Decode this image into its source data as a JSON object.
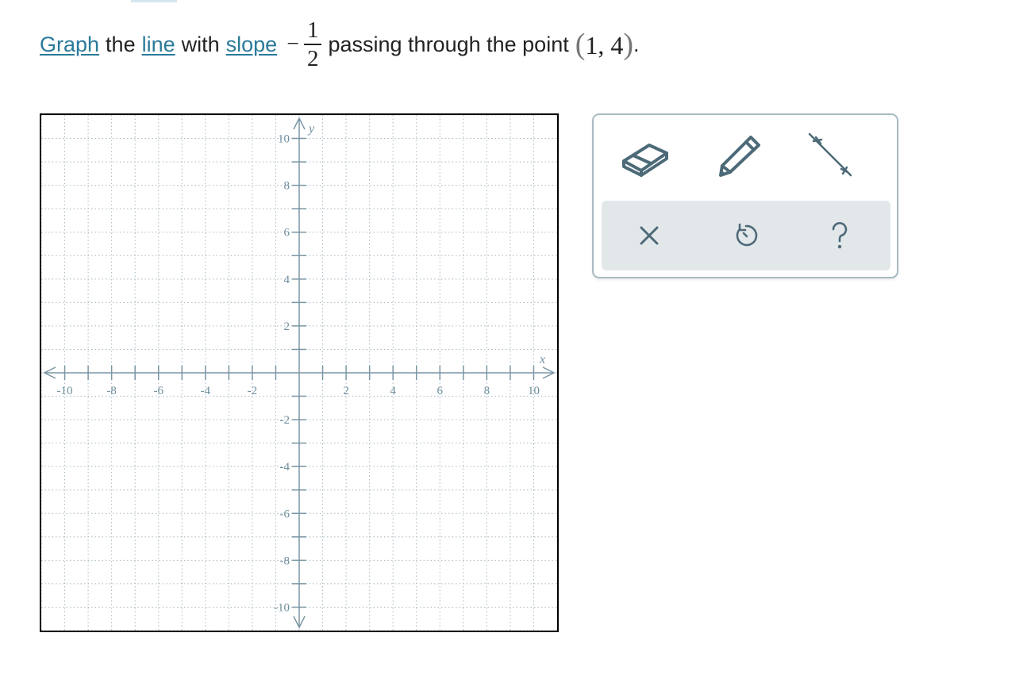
{
  "prompt": {
    "graph_link": "Graph",
    "text_the": "the",
    "line_link": "line",
    "text_with": "with",
    "slope_link": "slope",
    "minus": "−",
    "slope_numerator": "1",
    "slope_denominator": "2",
    "text_passing": "passing through the point",
    "point_open": "(",
    "point_x": "1",
    "point_comma": ",",
    "point_y": "4",
    "point_close": ")",
    "period": "."
  },
  "graph": {
    "x_axis_label": "x",
    "y_axis_label": "y",
    "x_min": -11,
    "x_max": 11,
    "y_min": -11,
    "y_max": 11,
    "x_tick_labels": [
      {
        "value": -10,
        "label": "-10"
      },
      {
        "value": -8,
        "label": "-8"
      },
      {
        "value": -6,
        "label": "-6"
      },
      {
        "value": -4,
        "label": "-4"
      },
      {
        "value": -2,
        "label": "-2"
      },
      {
        "value": 2,
        "label": "2"
      },
      {
        "value": 4,
        "label": "4"
      },
      {
        "value": 6,
        "label": "6"
      },
      {
        "value": 8,
        "label": "8"
      },
      {
        "value": 10,
        "label": "10"
      }
    ],
    "y_tick_labels": [
      {
        "value": 10,
        "label": "10"
      },
      {
        "value": 8,
        "label": "8"
      },
      {
        "value": 6,
        "label": "6"
      },
      {
        "value": 4,
        "label": "4"
      },
      {
        "value": 2,
        "label": "2"
      },
      {
        "value": -2,
        "label": "-2"
      },
      {
        "value": -4,
        "label": "-4"
      },
      {
        "value": -6,
        "label": "-6"
      },
      {
        "value": -8,
        "label": "-8"
      },
      {
        "value": -10,
        "label": "-10"
      }
    ],
    "grid": "dotted",
    "axis_color": "#7a95a3",
    "grid_color": "#a8b8c0"
  },
  "toolbar": {
    "tools": [
      {
        "name": "eraser-tool",
        "icon": "eraser-icon"
      },
      {
        "name": "pencil-tool",
        "icon": "pencil-icon"
      },
      {
        "name": "line-tool",
        "icon": "line-segment-icon"
      }
    ],
    "actions": [
      {
        "name": "clear-button",
        "icon": "close-icon"
      },
      {
        "name": "undo-button",
        "icon": "undo-icon"
      },
      {
        "name": "help-button",
        "icon": "help-icon"
      }
    ],
    "icon_color": "#4d6a78",
    "border_color": "#a9bac2",
    "actions_background": "#e2e7ea"
  }
}
